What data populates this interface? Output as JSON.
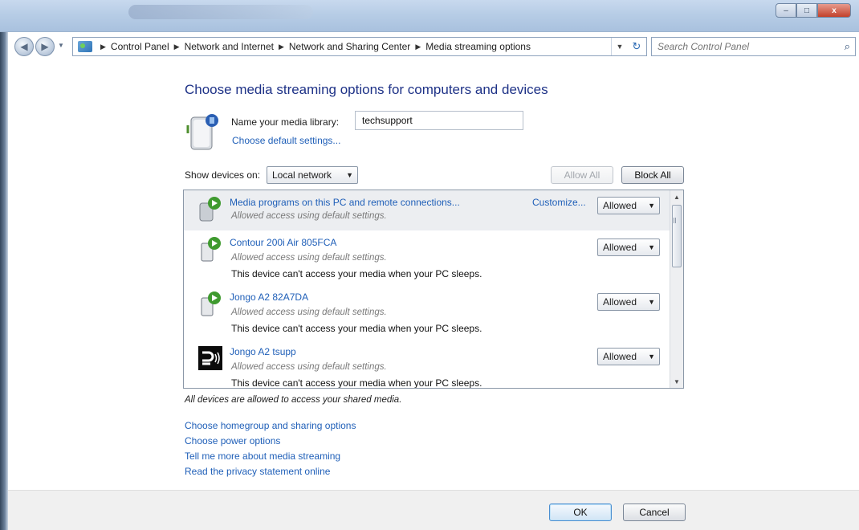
{
  "window": {
    "title_bar_text": "",
    "buttons": {
      "minimize": "–",
      "maximize": "□",
      "close": "x"
    }
  },
  "nav": {
    "back_icon": "arrow-left-icon",
    "forward_icon": "arrow-right-icon",
    "breadcrumbs": [
      "Control Panel",
      "Network and Internet",
      "Network and Sharing Center",
      "Media streaming options"
    ],
    "search_placeholder": "Search Control Panel"
  },
  "main": {
    "heading": "Choose media streaming options for computers and devices",
    "library_label": "Name your media library:",
    "library_value": "techsupport",
    "choose_default": "Choose default settings...",
    "show_devices_label": "Show devices on:",
    "show_devices_value": "Local network",
    "allow_all": "Allow All",
    "block_all": "Block All",
    "devices": [
      {
        "name": "Media programs on this PC and remote connections...",
        "status": "Allowed access using default settings.",
        "warning": "",
        "customize": "Customize...",
        "access": "Allowed",
        "selected": true,
        "icon": "media-server-icon"
      },
      {
        "name": "Contour 200i Air 805FCA",
        "status": "Allowed access using default settings.",
        "warning": "This device can't access your media when your PC sleeps.",
        "customize": "",
        "access": "Allowed",
        "selected": false,
        "icon": "media-device-icon"
      },
      {
        "name": "Jongo A2 82A7DA",
        "status": "Allowed access using default settings.",
        "warning": "This device can't access your media when your PC sleeps.",
        "customize": "",
        "access": "Allowed",
        "selected": false,
        "icon": "media-device-icon"
      },
      {
        "name": "Jongo A2 tsupp",
        "status": "Allowed access using default settings.",
        "warning": "This device can't access your media when your PC sleeps.",
        "customize": "",
        "access": "Allowed",
        "selected": false,
        "icon": "jongo-speaker-icon"
      }
    ],
    "all_allowed_note": "All devices are allowed to access your shared media.",
    "links": [
      "Choose homegroup and sharing options",
      "Choose power options",
      "Tell me more about media streaming",
      "Read the privacy statement online"
    ]
  },
  "footer": {
    "ok": "OK",
    "cancel": "Cancel"
  },
  "colors": {
    "link": "#1f5fb8",
    "heading": "#1e3287",
    "selected_row": "#eceef1"
  }
}
